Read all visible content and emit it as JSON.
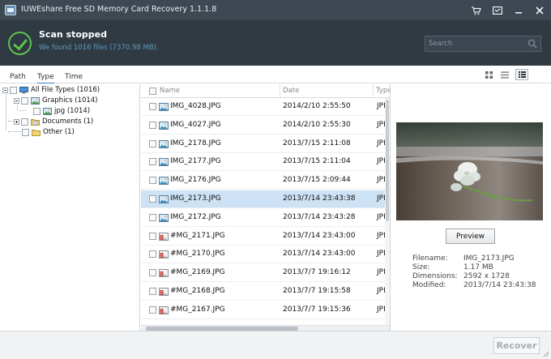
{
  "window": {
    "title": "IUWEshare Free SD Memory Card Recovery 1.1.1.8",
    "controls": [
      "cart-icon",
      "register-icon",
      "minimize-icon",
      "close-icon"
    ]
  },
  "status": {
    "title": "Scan stopped",
    "subtitle": "We found 1016 files (7370.98 MB).",
    "search_placeholder": "Search"
  },
  "view_tabs": [
    {
      "label": "Path",
      "active": false
    },
    {
      "label": "Type",
      "active": true
    },
    {
      "label": "Time",
      "active": false
    }
  ],
  "view_modes": [
    "thumbnail-view-icon",
    "list-view-icon",
    "detail-view-icon"
  ],
  "tree": [
    {
      "label": "All File Types (1016)",
      "level": 0,
      "expander": "minus",
      "icon": "computer-icon"
    },
    {
      "label": "Graphics (1014)",
      "level": 1,
      "expander": "minus",
      "icon": "picture-folder-icon"
    },
    {
      "label": "jpg (1014)",
      "level": 2,
      "expander": "none",
      "icon": "picture-folder-icon"
    },
    {
      "label": "Documents (1)",
      "level": 1,
      "expander": "plus",
      "icon": "document-folder-icon"
    },
    {
      "label": "Other (1)",
      "level": 1,
      "expander": "none",
      "icon": "folder-icon"
    }
  ],
  "list": {
    "columns": [
      "Name",
      "Date",
      "Type"
    ],
    "rows": [
      {
        "name": "IMG_4028.JPG",
        "date": "2014/2/10 2:55:50",
        "type": "JPI",
        "icon": "image",
        "selected": false
      },
      {
        "name": "IMG_4027.JPG",
        "date": "2014/2/10 2:55:30",
        "type": "JPI",
        "icon": "image",
        "selected": false
      },
      {
        "name": "IMG_2178.JPG",
        "date": "2013/7/15 2:11:08",
        "type": "JPI",
        "icon": "image",
        "selected": false
      },
      {
        "name": "IMG_2177.JPG",
        "date": "2013/7/15 2:11:04",
        "type": "JPI",
        "icon": "image",
        "selected": false
      },
      {
        "name": "IMG_2176.JPG",
        "date": "2013/7/15 2:09:44",
        "type": "JPI",
        "icon": "image",
        "selected": false
      },
      {
        "name": "IMG_2173.JPG",
        "date": "2013/7/14 23:43:38",
        "type": "JPI",
        "icon": "image",
        "selected": true
      },
      {
        "name": "IMG_2172.JPG",
        "date": "2013/7/14 23:43:28",
        "type": "JPI",
        "icon": "image",
        "selected": false
      },
      {
        "name": "#MG_2171.JPG",
        "date": "2013/7/14 23:43:00",
        "type": "JPI",
        "icon": "deleted-image",
        "selected": false
      },
      {
        "name": "#MG_2170.JPG",
        "date": "2013/7/14 23:43:00",
        "type": "JPI",
        "icon": "deleted-image",
        "selected": false
      },
      {
        "name": "#MG_2169.JPG",
        "date": "2013/7/7 19:16:12",
        "type": "JPI",
        "icon": "deleted-image",
        "selected": false
      },
      {
        "name": "#MG_2168.JPG",
        "date": "2013/7/7 19:15:58",
        "type": "JPI",
        "icon": "deleted-image",
        "selected": false
      },
      {
        "name": "#MG_2167.JPG",
        "date": "2013/7/7 19:15:36",
        "type": "JPI",
        "icon": "deleted-image",
        "selected": false
      }
    ]
  },
  "preview": {
    "button_label": "Preview",
    "meta": [
      {
        "label": "Filename:",
        "value": "IMG_2173.JPG"
      },
      {
        "label": "Size:",
        "value": "1.17 MB"
      },
      {
        "label": "Dimensions:",
        "value": "2592 x 1728"
      },
      {
        "label": "Modified:",
        "value": "2013/7/14 23:43:38"
      }
    ]
  },
  "footer": {
    "recover_label": "Recover"
  },
  "colors": {
    "titlebar": "#3d4852",
    "header": "#303a43",
    "accent_green": "#5bc44e",
    "subtitle_blue": "#5d99bd",
    "selection": "#cde2f5",
    "deleted_icon_red": "#c0392b"
  }
}
